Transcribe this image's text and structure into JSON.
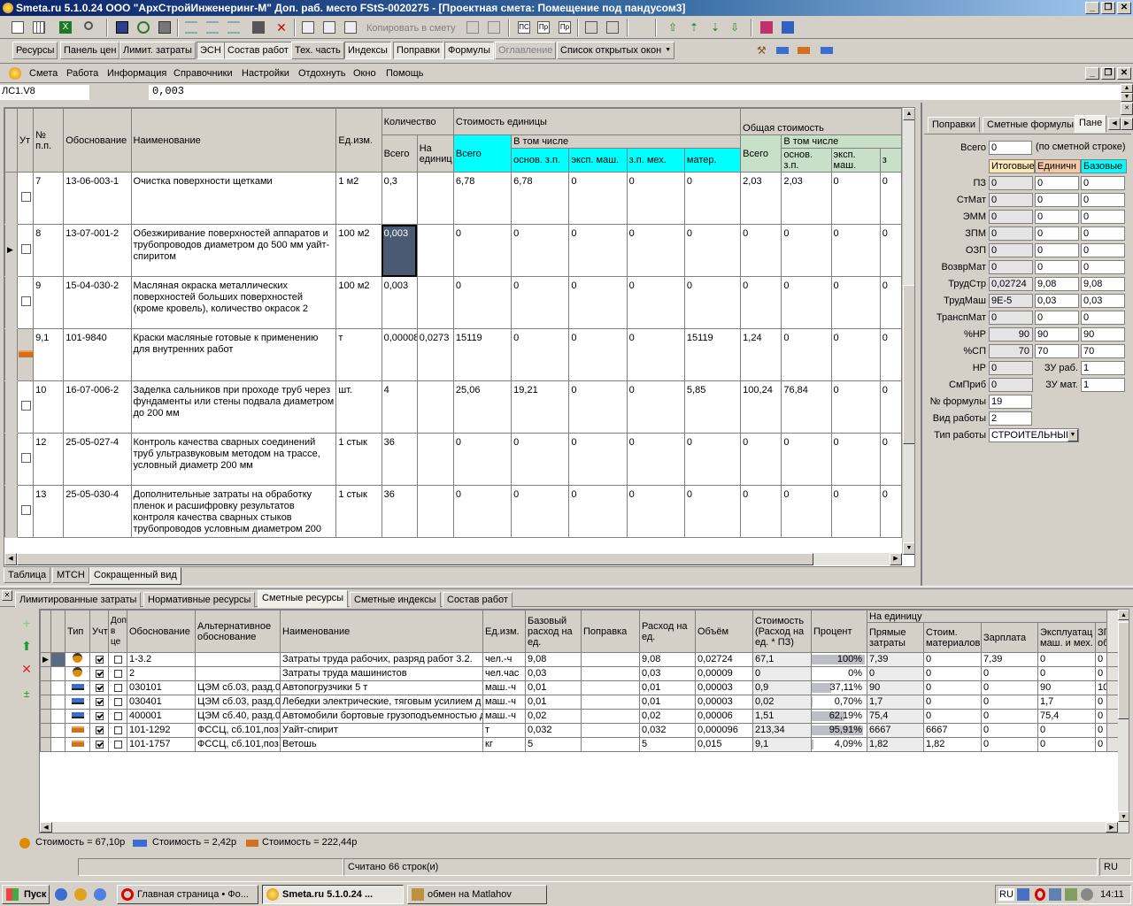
{
  "window": {
    "title": "Smeta.ru  5.1.0.24  ООО \"АрхСтройИнженеринг-М\"  Доп. раб. место  FStS-0020275 - [Проектная смета: Помещение под пандусом3]"
  },
  "panel_tabs": [
    "Ресурсы",
    "Панель цен",
    "Лимит. затраты",
    "ЭСН",
    "Состав работ",
    "Тех. часть",
    "Индексы",
    "Поправки",
    "Формулы",
    "Оглавление",
    "Список открытых окон"
  ],
  "toolbar": {
    "copy_label": "Копировать в смету"
  },
  "menu": [
    "Смета",
    "Работа",
    "Информация",
    "Справочники",
    "Настройки",
    "Отдохнуть",
    "Окно",
    "Помощь"
  ],
  "formula_bar": {
    "cell_ref": "ЛС1.V8",
    "value": "0,003"
  },
  "main_headers": {
    "ut": "Ут",
    "num": "№ п.п.",
    "basis": "Обоснование",
    "name": "Наименование",
    "unit": "Ед.изм.",
    "qty": "Количество",
    "qty_total": "Всего",
    "qty_per": "На единиц",
    "unit_cost": "Стоимость единицы",
    "uc_total": "Всего",
    "uc_incl": "В том числе",
    "uc_osn": "основ. з.п.",
    "uc_eksp": "эксп. маш.",
    "uc_zpmeh": "з.п. мех.",
    "uc_mat": "матер.",
    "total_cost": "Общая стоимость",
    "tc_total": "Всего",
    "tc_incl": "В том числе",
    "tc_osn": "основ. з.п.",
    "tc_eksp": "эксп. маш.",
    "tc_z": "з"
  },
  "rows": [
    {
      "num": "7",
      "basis": "13-06-003-1",
      "name": "Очистка поверхности щетками",
      "unit": "1 м2",
      "qty": "0,3",
      "per": "",
      "uc": "6,78",
      "osn": "6,78",
      "eksp": "0",
      "zpmeh": "0",
      "mat": "0",
      "tc": "2,03",
      "tosn": "2,03",
      "teksp": "0",
      "tz": "0",
      "kind": "check",
      "current": false
    },
    {
      "num": "8",
      "basis": "13-07-001-2",
      "name": "Обезжиривание поверхностей аппаратов и трубопроводов диаметром до 500 мм уайт-спиритом",
      "unit": "100 м2",
      "qty": "0,003",
      "per": "",
      "uc": "0",
      "osn": "0",
      "eksp": "0",
      "zpmeh": "0",
      "mat": "0",
      "tc": "0",
      "tosn": "0",
      "teksp": "0",
      "tz": "0",
      "kind": "check",
      "current": true
    },
    {
      "num": "9",
      "basis": "15-04-030-2",
      "name": "Масляная окраска металлических поверхностей больших поверхностей (кроме кровель), количество окрасок 2",
      "unit": "100 м2",
      "qty": "0,003",
      "per": "",
      "uc": "0",
      "osn": "0",
      "eksp": "0",
      "zpmeh": "0",
      "mat": "0",
      "tc": "0",
      "tosn": "0",
      "teksp": "0",
      "tz": "0",
      "kind": "check",
      "current": false
    },
    {
      "num": "9,1",
      "basis": "101-9840",
      "name": "Краски масляные готовые к применению для внутренних работ",
      "unit": "т",
      "qty": "0,00008",
      "per": "0,0273",
      "uc": "15119",
      "osn": "0",
      "eksp": "0",
      "zpmeh": "0",
      "mat": "15119",
      "tc": "1,24",
      "tosn": "0",
      "teksp": "0",
      "tz": "0",
      "kind": "material",
      "current": false
    },
    {
      "num": "10",
      "basis": "16-07-006-2",
      "name": "Заделка сальников при проходе труб через фундаменты или стены подвала диаметром до 200 мм",
      "unit": "шт.",
      "qty": "4",
      "per": "",
      "uc": "25,06",
      "osn": "19,21",
      "eksp": "0",
      "zpmeh": "0",
      "mat": "5,85",
      "tc": "100,24",
      "tosn": "76,84",
      "teksp": "0",
      "tz": "0",
      "kind": "check",
      "current": false
    },
    {
      "num": "12",
      "basis": "25-05-027-4",
      "name": "Контроль качества сварных соединений труб ультразвуковым методом на трассе, условный диаметр 200 мм",
      "unit": "1 стык",
      "qty": "36",
      "per": "",
      "uc": "0",
      "osn": "0",
      "eksp": "0",
      "zpmeh": "0",
      "mat": "0",
      "tc": "0",
      "tosn": "0",
      "teksp": "0",
      "tz": "0",
      "kind": "check",
      "current": false
    },
    {
      "num": "13",
      "basis": "25-05-030-4",
      "name": "Дополнительные затраты на обработку пленок и расшифровку результатов контроля качества сварных стыков трубопроводов условным диаметром 200",
      "unit": "1 стык",
      "qty": "36",
      "per": "",
      "uc": "0",
      "osn": "0",
      "eksp": "0",
      "zpmeh": "0",
      "mat": "0",
      "tc": "0",
      "tosn": "0",
      "teksp": "0",
      "tz": "0",
      "kind": "check",
      "current": false
    }
  ],
  "view_tabs": [
    "Таблица",
    "МТСН",
    "Сокращенный вид"
  ],
  "side_panel": {
    "tabs": [
      "Поправки",
      "Сметные формулы",
      "Пане"
    ],
    "total_label": "Всего",
    "total_value": "0",
    "total_note": "(по сметной строке)",
    "col_headers": [
      "Итоговые",
      "Единичн",
      "Базовые"
    ],
    "rows": [
      {
        "label": "ПЗ",
        "v": [
          "0",
          "0",
          "0"
        ]
      },
      {
        "label": "СтМат",
        "v": [
          "0",
          "0",
          "0"
        ]
      },
      {
        "label": "ЭММ",
        "v": [
          "0",
          "0",
          "0"
        ]
      },
      {
        "label": "ЗПМ",
        "v": [
          "0",
          "0",
          "0"
        ]
      },
      {
        "label": "ОЗП",
        "v": [
          "0",
          "0",
          "0"
        ]
      },
      {
        "label": "ВозврМат",
        "v": [
          "0",
          "0",
          "0"
        ]
      },
      {
        "label": "ТрудСтр",
        "v": [
          "0,02724",
          "9,08",
          "9,08"
        ]
      },
      {
        "label": "ТрудМаш",
        "v": [
          "9E-5",
          "0,03",
          "0,03"
        ]
      },
      {
        "label": "ТранспМат",
        "v": [
          "0",
          "0",
          "0"
        ]
      },
      {
        "label": "%НР",
        "v": [
          "90",
          "90",
          "90"
        ]
      },
      {
        "label": "%СП",
        "v": [
          "70",
          "70",
          "70"
        ]
      }
    ],
    "nr_label": "НР",
    "nr_value": "0",
    "zu_rab_label": "ЗУ раб.",
    "zu_rab_value": "1",
    "smprib_label": "СмПриб",
    "smprib_value": "0",
    "zu_mat_label": "ЗУ мат.",
    "zu_mat_value": "1",
    "formula_label": "№ формулы",
    "formula_value": "19",
    "vid_label": "Вид работы",
    "vid_value": "2",
    "tip_label": "Тип работы",
    "tip_value": "СТРОИТЕЛЬНЫЕ"
  },
  "bottom_tabs": [
    "Лимитированные затраты",
    "Нормативные ресурсы",
    "Сметные ресурсы",
    "Сметные индексы",
    "Состав работ"
  ],
  "res_headers": {
    "type": "Тип",
    "uch": "Учт",
    "dop": "Доп в це",
    "basis": "Обоснование",
    "alt": "Альтернативное обоснование",
    "name": "Наименование",
    "unit": "Ед.изм.",
    "base": "Базовый расход на ед.",
    "corr": "Поправка",
    "rate": "Расход на ед.",
    "vol": "Объём",
    "cost": "Стоимость (Расход на ед. * ПЗ)",
    "pct": "Процент",
    "per_unit": "На единицу",
    "direct": "Прямые затраты",
    "mat": "Стоим. материалов",
    "wage": "Зарплата",
    "expl": "Эксплуатац маш. и мех.",
    "zp": "ЗП об"
  },
  "resources": [
    {
      "kind": "worker",
      "basis": "1-3.2",
      "alt": "",
      "name": "Затраты труда рабочих, разряд работ 3.2.",
      "unit": "чел.-ч",
      "base": "9,08",
      "corr": "",
      "rate": "9,08",
      "vol": "0,02724",
      "cost": "67,1",
      "pct": "100%",
      "pct_val": 100,
      "direct": "7,39",
      "mat": "0",
      "wage": "7,39",
      "expl": "0",
      "zp": "0"
    },
    {
      "kind": "worker",
      "basis": "2",
      "alt": "",
      "name": "Затраты труда машинистов",
      "unit": "чел.час",
      "base": "0,03",
      "corr": "",
      "rate": "0,03",
      "vol": "0,00009",
      "cost": "0",
      "pct": "0%",
      "pct_val": 0,
      "direct": "0",
      "mat": "0",
      "wage": "0",
      "expl": "0",
      "zp": "0"
    },
    {
      "kind": "machine",
      "basis": "030101",
      "alt": "ЦЭМ сб.03, разд.0",
      "name": "Автопогрузчики 5 т",
      "unit": "маш.-ч",
      "base": "0,01",
      "corr": "",
      "rate": "0,01",
      "vol": "0,00003",
      "cost": "0,9",
      "pct": "37,11%",
      "pct_val": 37.11,
      "direct": "90",
      "mat": "0",
      "wage": "0",
      "expl": "90",
      "zp": "10"
    },
    {
      "kind": "machine",
      "basis": "030401",
      "alt": "ЦЭМ сб.03, разд.0",
      "name": "Лебедки электрические, тяговым усилием д",
      "unit": "маш.-ч",
      "base": "0,01",
      "corr": "",
      "rate": "0,01",
      "vol": "0,00003",
      "cost": "0,02",
      "pct": "0,70%",
      "pct_val": 0.7,
      "direct": "1,7",
      "mat": "0",
      "wage": "0",
      "expl": "1,7",
      "zp": "0"
    },
    {
      "kind": "machine",
      "basis": "400001",
      "alt": "ЦЭМ сб.40, разд.0",
      "name": "Автомобили бортовые грузоподъемностью д",
      "unit": "маш.-ч",
      "base": "0,02",
      "corr": "",
      "rate": "0,02",
      "vol": "0,00006",
      "cost": "1,51",
      "pct": "62,19%",
      "pct_val": 62.19,
      "direct": "75,4",
      "mat": "0",
      "wage": "0",
      "expl": "75,4",
      "zp": "0"
    },
    {
      "kind": "material",
      "basis": "101-1292",
      "alt": "ФССЦ, сб.101,поз",
      "name": "Уайт-спирит",
      "unit": "т",
      "base": "0,032",
      "corr": "",
      "rate": "0,032",
      "vol": "0,000096",
      "cost": "213,34",
      "pct": "95,91%",
      "pct_val": 95.91,
      "direct": "6667",
      "mat": "6667",
      "wage": "0",
      "expl": "0",
      "zp": "0"
    },
    {
      "kind": "material",
      "basis": "101-1757",
      "alt": "ФССЦ, сб.101,поз",
      "name": "Ветошь",
      "unit": "кг",
      "base": "5",
      "corr": "",
      "rate": "5",
      "vol": "0,015",
      "cost": "9,1",
      "pct": "4,09%",
      "pct_val": 4.09,
      "direct": "1,82",
      "mat": "1,82",
      "wage": "0",
      "expl": "0",
      "zp": "0"
    }
  ],
  "summary": [
    "Стоимость = 67,10р",
    "Стоимость = 2,42р",
    "Стоимость = 222,44р"
  ],
  "status": {
    "rows_counted": "Считано 66 строк(и)",
    "lang": "RU"
  },
  "taskbar": {
    "start": "Пуск",
    "tasks": [
      "Главная страница • Фо...",
      "Smeta.ru  5.1.0.24 ...",
      "обмен на Matlahov"
    ],
    "lang": "RU",
    "clock": "14:11"
  },
  "colors": {
    "title_start": "#0a246a",
    "title_end": "#a6caf0",
    "cyan_header": "#00ffff",
    "green_header": "#c8e0c8",
    "selection": "#4a5a72"
  }
}
